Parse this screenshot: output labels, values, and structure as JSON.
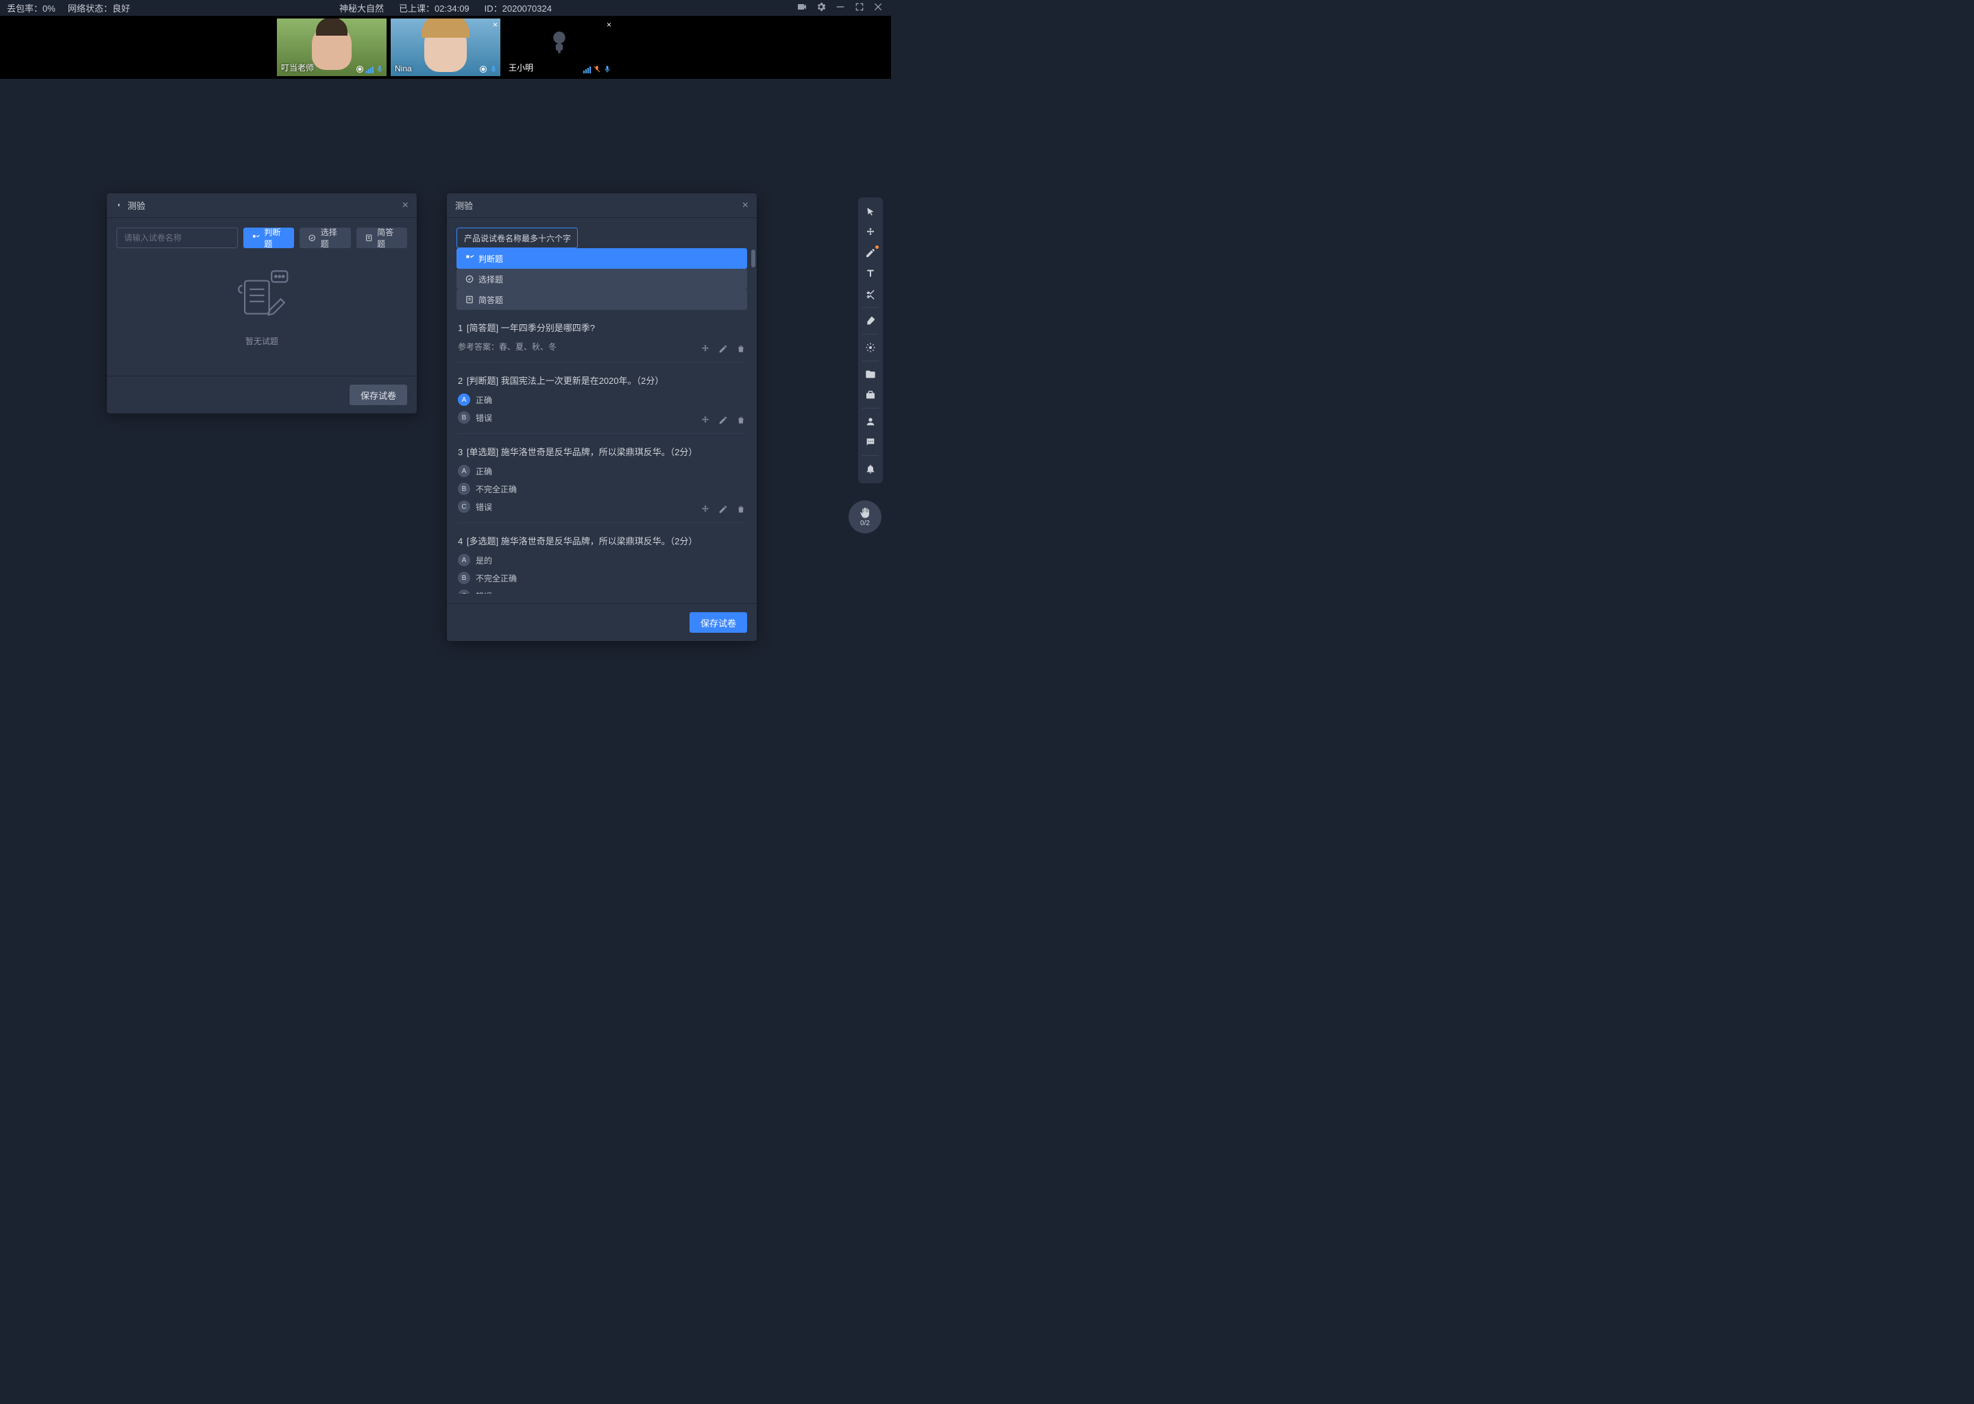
{
  "status": {
    "packet_loss_label": "丢包率：",
    "packet_loss_value": "0%",
    "network_label": "网络状态：",
    "network_value": "良好",
    "class_title": "神秘大自然",
    "elapsed_label": "已上课：",
    "elapsed_value": "02:34:09",
    "id_label": "ID：",
    "id_value": "2020070324"
  },
  "videos": [
    {
      "name": "叮当老师",
      "cam_on": true,
      "closeable": false,
      "muted": false
    },
    {
      "name": "Nina",
      "cam_on": true,
      "closeable": true,
      "muted": false
    },
    {
      "name": "王小明",
      "cam_on": false,
      "closeable": true,
      "muted": true
    }
  ],
  "panelA": {
    "title": "测验",
    "placeholder": "请输入试卷名称",
    "filters": {
      "judge": "判断题",
      "choice": "选择题",
      "short": "简答题"
    },
    "empty": "暂无试题",
    "save": "保存试卷"
  },
  "panelB": {
    "title": "测验",
    "quiz_name": "产品说试卷名称最多十六个字",
    "filters": {
      "judge": "判断题",
      "choice": "选择题",
      "short": "简答题"
    },
    "save": "保存试卷",
    "questions": [
      {
        "num": "1",
        "type": "[简答题]",
        "text": "一年四季分别是哪四季?",
        "answer_label": "参考答案：",
        "answer": "春、夏、秋、冬"
      },
      {
        "num": "2",
        "type": "[判断题]",
        "text": "我国宪法上一次更新是在2020年。（2分）",
        "options": [
          {
            "letter": "A",
            "text": "正确",
            "correct": true
          },
          {
            "letter": "B",
            "text": "错误",
            "correct": false
          }
        ]
      },
      {
        "num": "3",
        "type": "[单选题]",
        "text": "施华洛世奇是反华品牌，所以梁鼎琪反华。（2分）",
        "options": [
          {
            "letter": "A",
            "text": "正确",
            "correct": false
          },
          {
            "letter": "B",
            "text": "不完全正确",
            "correct": false
          },
          {
            "letter": "C",
            "text": "错误",
            "correct": false
          }
        ]
      },
      {
        "num": "4",
        "type": "[多选题]",
        "text": "施华洛世奇是反华品牌，所以梁鼎琪反华。（2分）",
        "options": [
          {
            "letter": "A",
            "text": "是的",
            "correct": false
          },
          {
            "letter": "B",
            "text": "不完全正确",
            "correct": false
          },
          {
            "letter": "C",
            "text": "错误",
            "correct": false
          }
        ]
      }
    ]
  },
  "hand": {
    "count": "0/2"
  }
}
